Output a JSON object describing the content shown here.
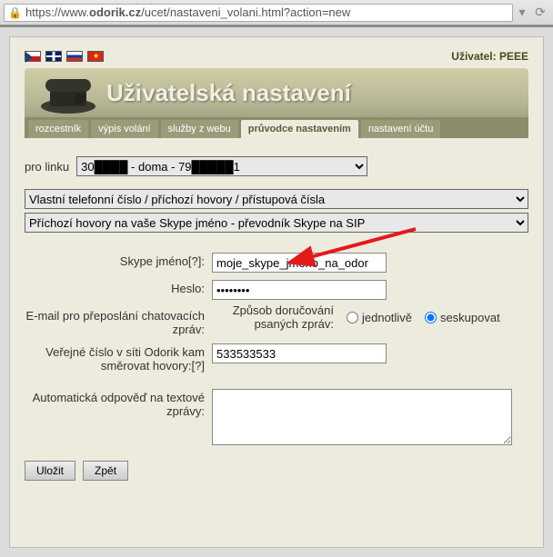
{
  "browser": {
    "url_display": "https://www.odorik.cz/ucet/nastaveni_volani.html?action=new",
    "url_bold": "odorik.cz"
  },
  "header": {
    "user_prefix": "Uživatel:",
    "user_name": "PEEE",
    "title": "Uživatelská nastavení"
  },
  "tabs": [
    {
      "label": "rozcestník",
      "active": false
    },
    {
      "label": "výpis volání",
      "active": false
    },
    {
      "label": "služby z webu",
      "active": false
    },
    {
      "label": "průvodce nastavením",
      "active": true
    },
    {
      "label": "nastavení účtu",
      "active": false
    }
  ],
  "linka": {
    "label": "pro linku",
    "selected": "30████ - doma - 79█████1"
  },
  "selectors": {
    "sel1": "Vlastní telefonní číslo / příchozí hovory / přístupová čísla",
    "sel2": "Příchozí hovory na vaše Skype jméno - převodník Skype na SIP"
  },
  "form": {
    "skype_label": "Skype jméno[?]:",
    "skype_value": "moje_skype_jmeno_na_odor",
    "heslo_label": "Heslo:",
    "heslo_value": "********",
    "email_label": "E-mail pro přeposlání chatovacích zpráv:",
    "zpusob_label": "Způsob doručování psaných zpráv:",
    "zpusob_opt1": "jednotlivě",
    "zpusob_opt2": "seskupovat",
    "verejne_label": "Veřejné číslo v síti Odorik kam směrovat hovory:[?]",
    "verejne_value": "533533533",
    "auto_label": "Automatická odpověď na textové zprávy:",
    "auto_value": ""
  },
  "buttons": {
    "save": "Uložit",
    "back": "Zpět"
  }
}
